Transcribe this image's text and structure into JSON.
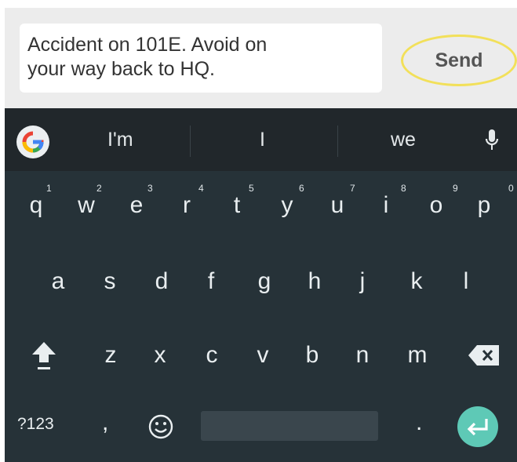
{
  "message": {
    "text_line1": "Accident on 101E. Avoid on",
    "text_line2": "your way back to HQ.",
    "send_label": "Send"
  },
  "keyboard": {
    "suggestions": [
      "I'm",
      "I",
      "we"
    ],
    "row1": [
      {
        "key": "q",
        "hint": "1"
      },
      {
        "key": "w",
        "hint": "2"
      },
      {
        "key": "e",
        "hint": "3"
      },
      {
        "key": "r",
        "hint": "4"
      },
      {
        "key": "t",
        "hint": "5"
      },
      {
        "key": "y",
        "hint": "6"
      },
      {
        "key": "u",
        "hint": "7"
      },
      {
        "key": "i",
        "hint": "8"
      },
      {
        "key": "o",
        "hint": "9"
      },
      {
        "key": "p",
        "hint": "0"
      }
    ],
    "row2": [
      "a",
      "s",
      "d",
      "f",
      "g",
      "h",
      "j",
      "k",
      "l"
    ],
    "row3": [
      "z",
      "x",
      "c",
      "v",
      "b",
      "n",
      "m"
    ],
    "symbols_label": "?123",
    "comma": ",",
    "period": ".",
    "icons": [
      "google-logo",
      "mic-icon",
      "shift-icon",
      "backspace-icon",
      "emoji-icon",
      "enter-icon"
    ],
    "colors": {
      "keyboard_bg": "#263238",
      "suggestion_bg": "#21272b",
      "enter_accent": "#5ec9b6",
      "send_highlight": "#f2e05a"
    }
  }
}
